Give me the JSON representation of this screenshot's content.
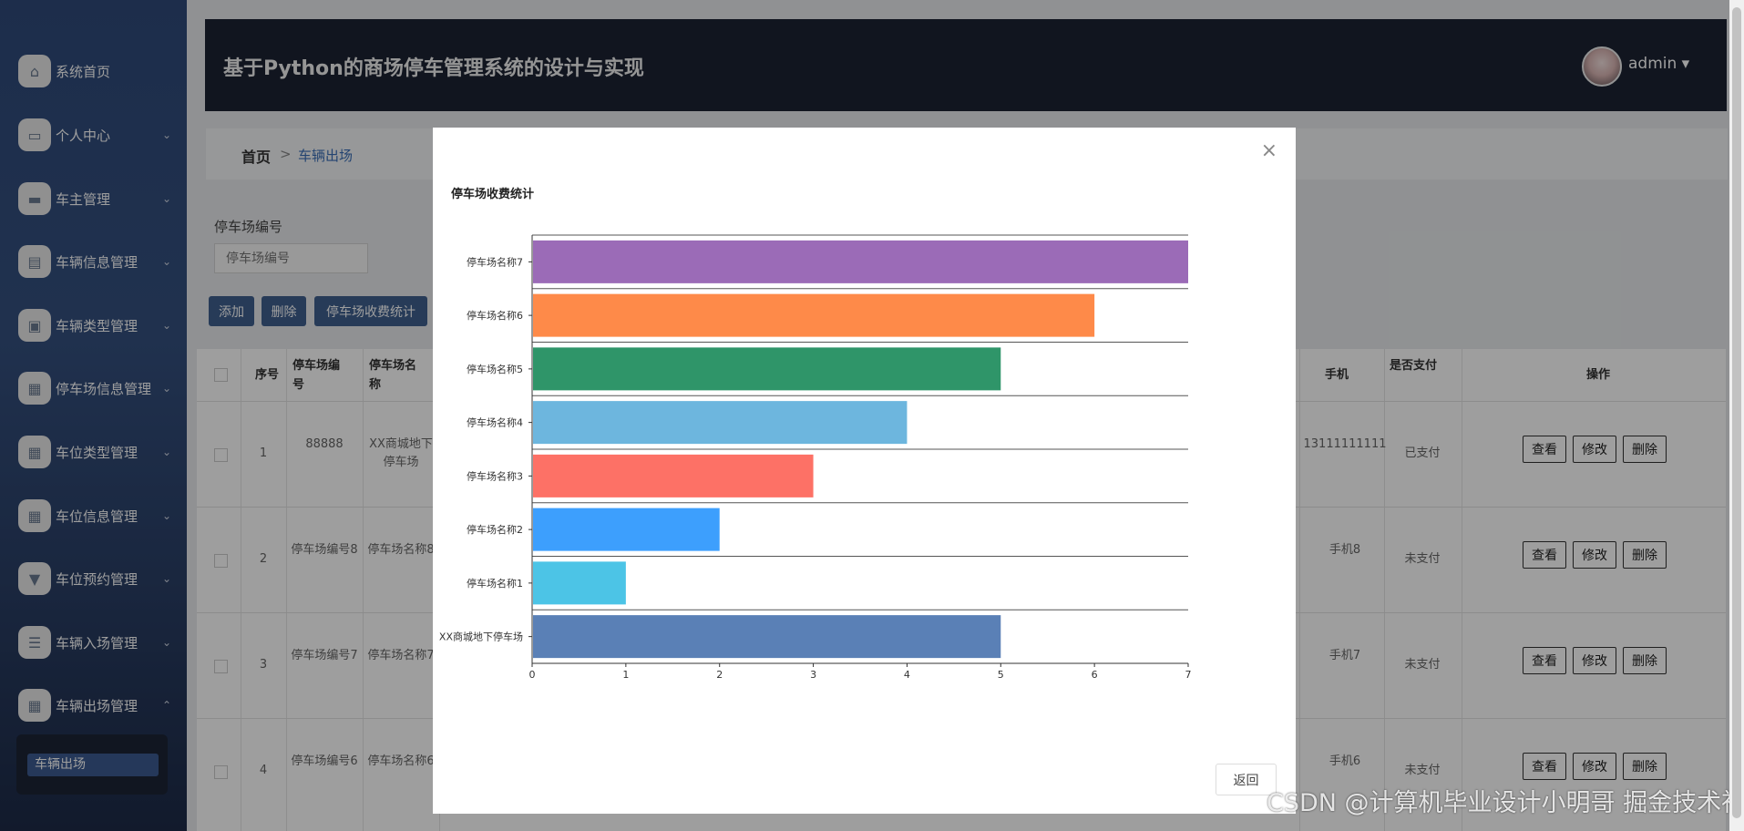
{
  "sidebar": {
    "items": [
      {
        "label": "系统首页",
        "icon": "home-icon",
        "glyph": "⌂",
        "chevron": ""
      },
      {
        "label": "个人中心",
        "icon": "card-icon",
        "glyph": "▭",
        "chevron": "⌄"
      },
      {
        "label": "车主管理",
        "icon": "briefcase-icon",
        "glyph": "▬",
        "chevron": "⌄"
      },
      {
        "label": "车辆信息管理",
        "icon": "clipboard-icon",
        "glyph": "▤",
        "chevron": "⌄"
      },
      {
        "label": "车辆类型管理",
        "icon": "monitor-icon",
        "glyph": "▣",
        "chevron": "⌄"
      },
      {
        "label": "停车场信息管理",
        "icon": "grid-icon",
        "glyph": "▦",
        "chevron": "⌄"
      },
      {
        "label": "车位类型管理",
        "icon": "grid-icon",
        "glyph": "▦",
        "chevron": "⌄"
      },
      {
        "label": "车位信息管理",
        "icon": "grid-icon",
        "glyph": "▦",
        "chevron": "⌄"
      },
      {
        "label": "车位预约管理",
        "icon": "pin-icon",
        "glyph": "▼",
        "chevron": "⌄"
      },
      {
        "label": "车辆入场管理",
        "icon": "sliders-icon",
        "glyph": "☰",
        "chevron": "⌄"
      },
      {
        "label": "车辆出场管理",
        "icon": "grid-icon",
        "glyph": "▦",
        "chevron": "⌃"
      }
    ],
    "submenu_active": "车辆出场"
  },
  "header": {
    "title": "基于Python的商场停车管理系统的设计与实现",
    "user": "admin ▾"
  },
  "breadcrumb": {
    "home": "首页",
    "separator": ">",
    "current": "车辆出场"
  },
  "search": {
    "label": "停车场编号",
    "placeholder": "停车场编号"
  },
  "toolbar": {
    "add": "添加",
    "delete": "删除",
    "stats": "停车场收费统计"
  },
  "table": {
    "headers": {
      "index": "序号",
      "lot_no": "停车场编号",
      "lot_name": "停车场名称",
      "phone": "手机",
      "paid": "是否支付",
      "ops": "操作"
    },
    "rows": [
      {
        "index": "1",
        "lot_no": "88888",
        "lot_name": "XX商城地下停车场",
        "phone": "13111111111",
        "paid": "已支付"
      },
      {
        "index": "2",
        "lot_no": "停车场编号8",
        "lot_name": "停车场名称8",
        "phone": "手机8",
        "paid": "未支付"
      },
      {
        "index": "3",
        "lot_no": "停车场编号7",
        "lot_name": "停车场名称7",
        "phone": "手机7",
        "paid": "未支付"
      },
      {
        "index": "4",
        "lot_no": "停车场编号6",
        "lot_name": "停车场名称6",
        "phone": "手机6",
        "paid": "未支付"
      }
    ],
    "ops": {
      "view": "查看",
      "edit": "修改",
      "delete": "删除"
    }
  },
  "modal": {
    "close": "×",
    "back": "返回"
  },
  "chart_data": {
    "type": "bar",
    "orientation": "horizontal",
    "title": "停车场收费统计",
    "categories": [
      "停车场名称7",
      "停车场名称6",
      "停车场名称5",
      "停车场名称4",
      "停车场名称3",
      "停车场名称2",
      "停车场名称1",
      "XX商城地下停车场"
    ],
    "values": [
      7,
      6,
      5,
      4,
      3,
      2,
      1,
      5
    ],
    "colors": [
      "#9b6bb7",
      "#fe8a49",
      "#2f9569",
      "#6db6de",
      "#fd7166",
      "#3d9ffd",
      "#4cc4e6",
      "#5a80b6"
    ],
    "xlim": [
      0,
      7
    ],
    "xticks": [
      "0",
      "1",
      "2",
      "3",
      "4",
      "5",
      "6",
      "7"
    ],
    "grid": true,
    "xlabel": "",
    "ylabel": ""
  },
  "watermark": "CSDN @计算机毕业设计小明哥  掘金技术社区"
}
